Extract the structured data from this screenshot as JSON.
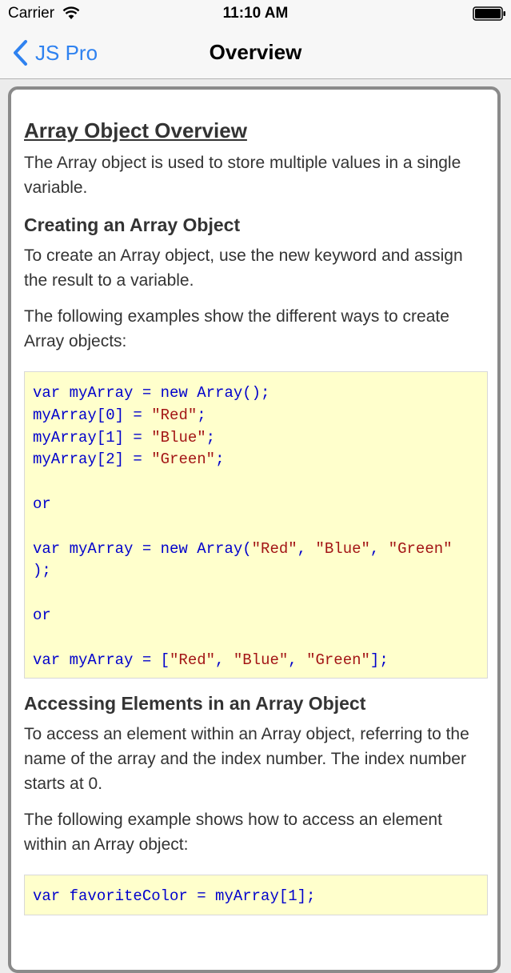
{
  "status_bar": {
    "carrier": "Carrier",
    "time": "11:10 AM"
  },
  "nav": {
    "back_label": "JS Pro",
    "title": "Overview"
  },
  "article": {
    "heading": "Array Object Overview",
    "intro": "The Array object is used to store multiple values in a single variable.",
    "section1_heading": "Creating an Array Object",
    "section1_p1": "To create an Array object, use the new keyword and assign the result to a variable.",
    "section1_p2": "The following examples show the different ways to create Array objects:",
    "code1": {
      "l1_a": "var myArray = new Array();",
      "l2_a": "myArray[0] = ",
      "l2_s": "\"Red\"",
      "l2_e": ";",
      "l3_a": "myArray[1] = ",
      "l3_s": "\"Blue\"",
      "l3_e": ";",
      "l4_a": "myArray[2] = ",
      "l4_s": "\"Green\"",
      "l4_e": ";",
      "or1": "or",
      "l6_a": "var myArray = new Array(",
      "l6_s1": "\"Red\"",
      "l6_c1": ", ",
      "l6_s2": "\"Blue\"",
      "l6_c2": ", ",
      "l6_s3": "\"Green\"",
      "l7": ");",
      "or2": "or",
      "l9_a": "var myArray = [",
      "l9_s1": "\"Red\"",
      "l9_c1": ", ",
      "l9_s2": "\"Blue\"",
      "l9_c2": ", ",
      "l9_s3": "\"Green\"",
      "l9_e": "];"
    },
    "section2_heading": "Accessing Elements in an Array Object",
    "section2_p1": "To access an element within an Array object, referring to the name of the array and the index number. The index number starts at 0.",
    "section2_p2": "The following example shows how to access an element within an Array object:",
    "code2": {
      "l1": "var favoriteColor = myArray[1];"
    }
  },
  "colors": {
    "accent": "#2f82f0",
    "code_bg": "#ffffcc",
    "code_keyword": "#0000cc",
    "code_string": "#a31515"
  }
}
